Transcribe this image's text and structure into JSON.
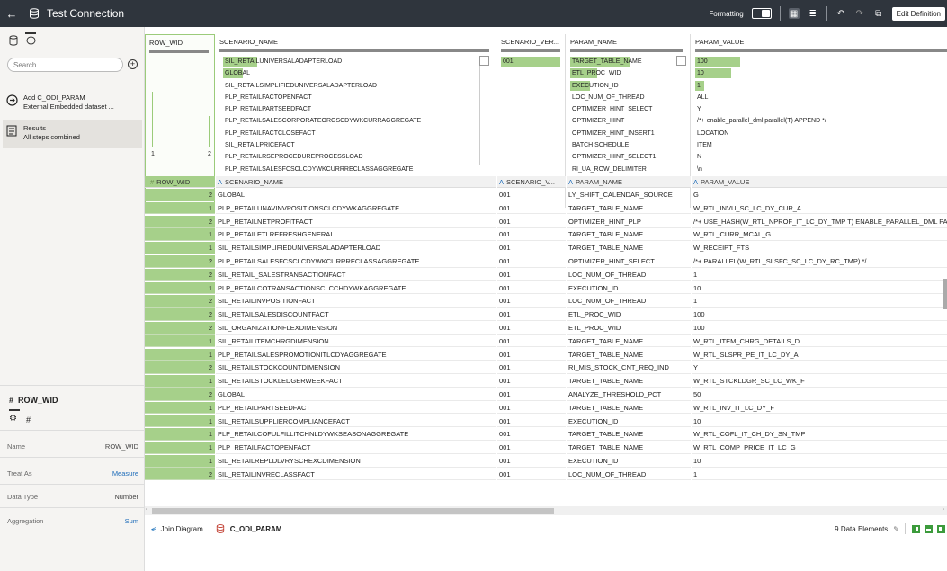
{
  "header": {
    "title": "Test Connection",
    "formatting_label": "Formatting",
    "edit_label": "Edit Definition"
  },
  "sidebar": {
    "search_placeholder": "Search",
    "steps": [
      {
        "title": "Add C_ODI_PARAM",
        "subtitle": "External Embedded dataset ..."
      },
      {
        "title": "Results",
        "subtitle": "All steps combined"
      }
    ],
    "column_title": "ROW_WID",
    "column_type_symbol": "#",
    "properties": [
      {
        "label": "Name",
        "value": "ROW_WID"
      },
      {
        "label": "Treat As",
        "value": "Measure"
      },
      {
        "label": "Data Type",
        "value": "Number"
      },
      {
        "label": "Aggregation",
        "value": "Sum"
      }
    ]
  },
  "profiles": {
    "row_wid": {
      "title": "ROW_WID",
      "min": "1",
      "max": "2"
    },
    "scenario_name": {
      "title": "SCENARIO_NAME",
      "values": [
        "SIL_RETAILUNIVERSALADAPTERLOAD",
        "GLOBAL",
        "SIL_RETAILSIMPLIFIEDUNIVERSALADAPTERLOAD",
        "PLP_RETAILFACTOPENFACT",
        "PLP_RETAILPARTSEEDFACT",
        "PLP_RETAILSALESCORPORATEORGSCDYWKCURRAGGREGATE",
        "PLP_RETAILFACTCLOSEFACT",
        "SIL_RETAILPRICEFACT",
        "PLP_RETAILRSEPROCEDUREPROCESSLOAD",
        "PLP_RETAILSALESFCSCLCDYWKCURRRECLASSAGGREGATE"
      ]
    },
    "scenario_version": {
      "title": "SCENARIO_VER...",
      "values": [
        "001"
      ]
    },
    "param_name": {
      "title": "PARAM_NAME",
      "values": [
        "TARGET_TABLE_NAME",
        "ETL_PROC_WID",
        "EXECUTION_ID",
        "LOC_NUM_OF_THREAD",
        "OPTIMIZER_HINT_SELECT",
        "OPTIMIZER_HINT",
        "OPTIMIZER_HINT_INSERT1",
        "BATCH SCHEDULE",
        "OPTIMIZER_HINT_SELECT1",
        "RI_UA_ROW_DELIMITER"
      ]
    },
    "param_value": {
      "title": "PARAM_VALUE",
      "values": [
        "100",
        "10",
        "1",
        "ALL",
        "Y",
        "/*+ enable_parallel_dml parallel(T) APPEND */",
        "LOCATION",
        "ITEM",
        "N",
        "\\n"
      ]
    }
  },
  "columns": [
    {
      "type": "#",
      "name": "ROW_WID"
    },
    {
      "type": "A",
      "name": "SCENARIO_NAME"
    },
    {
      "type": "A",
      "name": "SCENARIO_V..."
    },
    {
      "type": "A",
      "name": "PARAM_NAME"
    },
    {
      "type": "A",
      "name": "PARAM_VALUE"
    }
  ],
  "rows": [
    [
      "2",
      "GLOBAL",
      "001",
      "LY_SHIFT_CALENDAR_SOURCE",
      "G"
    ],
    [
      "1",
      "PLP_RETAILUNAVINVPOSITIONSCLCDYWKAGGREGATE",
      "001",
      "TARGET_TABLE_NAME",
      "W_RTL_INVU_SC_LC_DY_CUR_A"
    ],
    [
      "2",
      "PLP_RETAILNETPROFITFACT",
      "001",
      "OPTIMIZER_HINT_PLP",
      "/*+ USE_HASH(W_RTL_NPROF_IT_LC_DY_TMP T) ENABLE_PARALLEL_DML PA"
    ],
    [
      "1",
      "PLP_RETAILETLREFRESHGENERAL",
      "001",
      "TARGET_TABLE_NAME",
      "W_RTL_CURR_MCAL_G"
    ],
    [
      "1",
      "SIL_RETAILSIMPLIFIEDUNIVERSALADAPTERLOAD",
      "001",
      "TARGET_TABLE_NAME",
      "W_RECEIPT_FTS"
    ],
    [
      "2",
      "PLP_RETAILSALESFCSCLCDYWKCURRRECLASSAGGREGATE",
      "001",
      "OPTIMIZER_HINT_SELECT",
      "/*+ PARALLEL(W_RTL_SLSFC_SC_LC_DY_RC_TMP) */"
    ],
    [
      "2",
      "SIL_RETAIL_SALESTRANSACTIONFACT",
      "001",
      "LOC_NUM_OF_THREAD",
      "1"
    ],
    [
      "1",
      "PLP_RETAILCOTRANSACTIONSCLCCHDYWKAGGREGATE",
      "001",
      "EXECUTION_ID",
      "10"
    ],
    [
      "2",
      "SIL_RETAILINVPOSITIONFACT",
      "001",
      "LOC_NUM_OF_THREAD",
      "1"
    ],
    [
      "2",
      "SIL_RETAILSALESDISCOUNTFACT",
      "001",
      "ETL_PROC_WID",
      "100"
    ],
    [
      "2",
      "SIL_ORGANIZATIONFLEXDIMENSION",
      "001",
      "ETL_PROC_WID",
      "100"
    ],
    [
      "1",
      "SIL_RETAILITEMCHRGDIMENSION",
      "001",
      "TARGET_TABLE_NAME",
      "W_RTL_ITEM_CHRG_DETAILS_D"
    ],
    [
      "1",
      "PLP_RETAILSALESPROMOTIONITLCDYAGGREGATE",
      "001",
      "TARGET_TABLE_NAME",
      "W_RTL_SLSPR_PE_IT_LC_DY_A"
    ],
    [
      "2",
      "SIL_RETAILSTOCKCOUNTDIMENSION",
      "001",
      "RI_MIS_STOCK_CNT_REQ_IND",
      "Y"
    ],
    [
      "1",
      "SIL_RETAILSTOCKLEDGERWEEKFACT",
      "001",
      "TARGET_TABLE_NAME",
      "W_RTL_STCKLDGR_SC_LC_WK_F"
    ],
    [
      "2",
      "GLOBAL",
      "001",
      "ANALYZE_THRESHOLD_PCT",
      "50"
    ],
    [
      "1",
      "PLP_RETAILPARTSEEDFACT",
      "001",
      "TARGET_TABLE_NAME",
      "W_RTL_INV_IT_LC_DY_F"
    ],
    [
      "1",
      "SIL_RETAILSUPPLIERCOMPLIANCEFACT",
      "001",
      "EXECUTION_ID",
      "10"
    ],
    [
      "1",
      "PLP_RETAILCOFULFILLITCHNLDYWKSEASONAGGREGATE",
      "001",
      "TARGET_TABLE_NAME",
      "W_RTL_COFL_IT_CH_DY_SN_TMP"
    ],
    [
      "1",
      "PLP_RETAILFACTOPENFACT",
      "001",
      "TARGET_TABLE_NAME",
      "W_RTL_COMP_PRICE_IT_LC_G"
    ],
    [
      "1",
      "SIL_RETAILREPLDLVRYSCHEXCDIMENSION",
      "001",
      "EXECUTION_ID",
      "10"
    ],
    [
      "2",
      "SIL_RETAILINVRECLASSFACT",
      "001",
      "LOC_NUM_OF_THREAD",
      "1"
    ]
  ],
  "footer": {
    "join_label": "Join Diagram",
    "dataset_label": "C_ODI_PARAM",
    "elements_label": "9 Data Elements"
  },
  "colors": {
    "accent": "#a6d08a",
    "topbar": "#2f353d",
    "link": "#1f6dba"
  }
}
